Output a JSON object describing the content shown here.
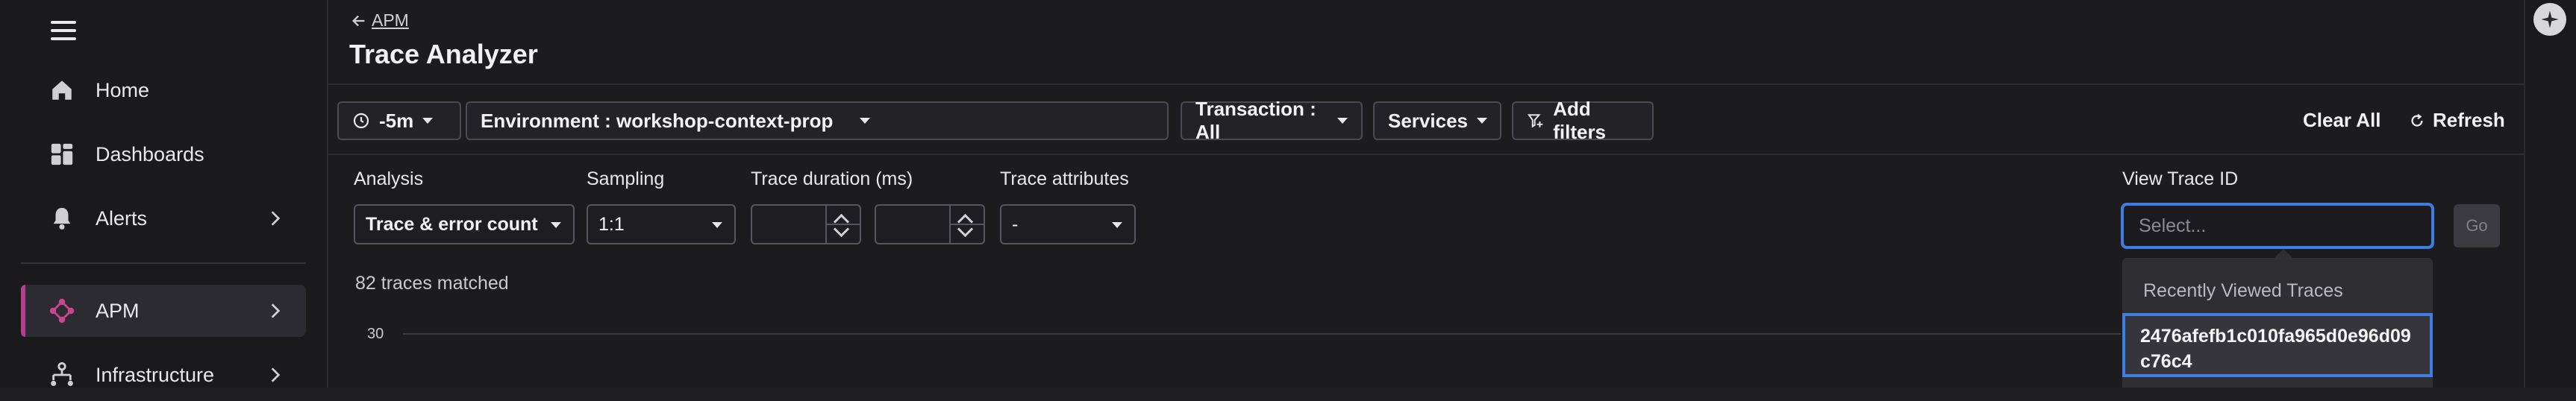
{
  "sidebar": {
    "items": [
      {
        "label": "Home",
        "icon": "home-icon"
      },
      {
        "label": "Dashboards",
        "icon": "dashboards-icon"
      },
      {
        "label": "Alerts",
        "icon": "bell-icon"
      },
      {
        "label": "APM",
        "icon": "apm-icon",
        "selected": true
      },
      {
        "label": "Infrastructure",
        "icon": "infrastructure-icon"
      }
    ]
  },
  "header": {
    "back_label": "APM",
    "title": "Trace Analyzer"
  },
  "filters": {
    "time": "-5m",
    "environment": "Environment : workshop-context-prop",
    "transaction": "Transaction : All",
    "services": "Services",
    "add_filters": "Add filters",
    "clear_all": "Clear All",
    "refresh": "Refresh"
  },
  "analysis": {
    "analysis_label": "Analysis",
    "analysis_value": "Trace & error count",
    "sampling_label": "Sampling",
    "sampling_value": "1:1",
    "duration_label": "Trace duration (ms)",
    "attributes_label": "Trace attributes",
    "attributes_value": "-",
    "view_trace_label": "View Trace ID",
    "trace_placeholder": "Select...",
    "go_label": "Go"
  },
  "dropdown": {
    "heading": "Recently Viewed Traces",
    "options": [
      "2476afefb1c010fa965d0e96d09c76c4"
    ]
  },
  "results": {
    "matched": "82 traces matched",
    "y_tick": "30"
  },
  "colors": {
    "accent_blue": "#3f7ee0",
    "apm_pink": "#b43e8f"
  }
}
